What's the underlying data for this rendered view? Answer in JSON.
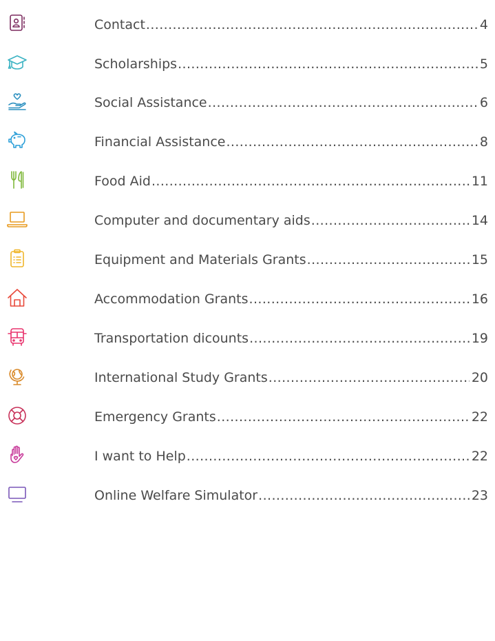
{
  "toc": {
    "entries": [
      {
        "label": "Contact",
        "page": "4",
        "icon": "contact-card-icon",
        "color": "#7b2a5e"
      },
      {
        "label": "Scholarships",
        "page": "5",
        "icon": "graduation-cap-icon",
        "color": "#3bb3c3"
      },
      {
        "label": "Social Assistance",
        "page": "6",
        "icon": "heart-hand-icon",
        "color": "#2a8fbf"
      },
      {
        "label": "Financial Assistance",
        "page": "8",
        "icon": "piggy-bank-icon",
        "color": "#2a9ed8"
      },
      {
        "label": "Food Aid",
        "page": "11",
        "icon": "fork-knife-icon",
        "color": "#7fb83a"
      },
      {
        "label": "Computer and documentary aids",
        "page": "14",
        "icon": "laptop-icon",
        "color": "#e89a1e"
      },
      {
        "label": "Equipment and Materials Grants",
        "page": "15",
        "icon": "clipboard-icon",
        "color": "#f0b62a"
      },
      {
        "label": "Accommodation Grants",
        "page": "16",
        "icon": "house-icon",
        "color": "#e8493a"
      },
      {
        "label": "Transportation dicounts",
        "page": "19",
        "icon": "bus-icon",
        "color": "#e8336d"
      },
      {
        "label": "International Study Grants",
        "page": "20",
        "icon": "globe-icon",
        "color": "#d98a2a"
      },
      {
        "label": "Emergency Grants",
        "page": "22",
        "icon": "lifebuoy-icon",
        "color": "#c8325a"
      },
      {
        "label": "I want to Help",
        "page": "22",
        "icon": "raised-hand-heart-icon",
        "color": "#c83a9a"
      },
      {
        "label": "Online Welfare Simulator",
        "page": "23",
        "icon": "monitor-icon",
        "color": "#7a56b8"
      }
    ]
  }
}
